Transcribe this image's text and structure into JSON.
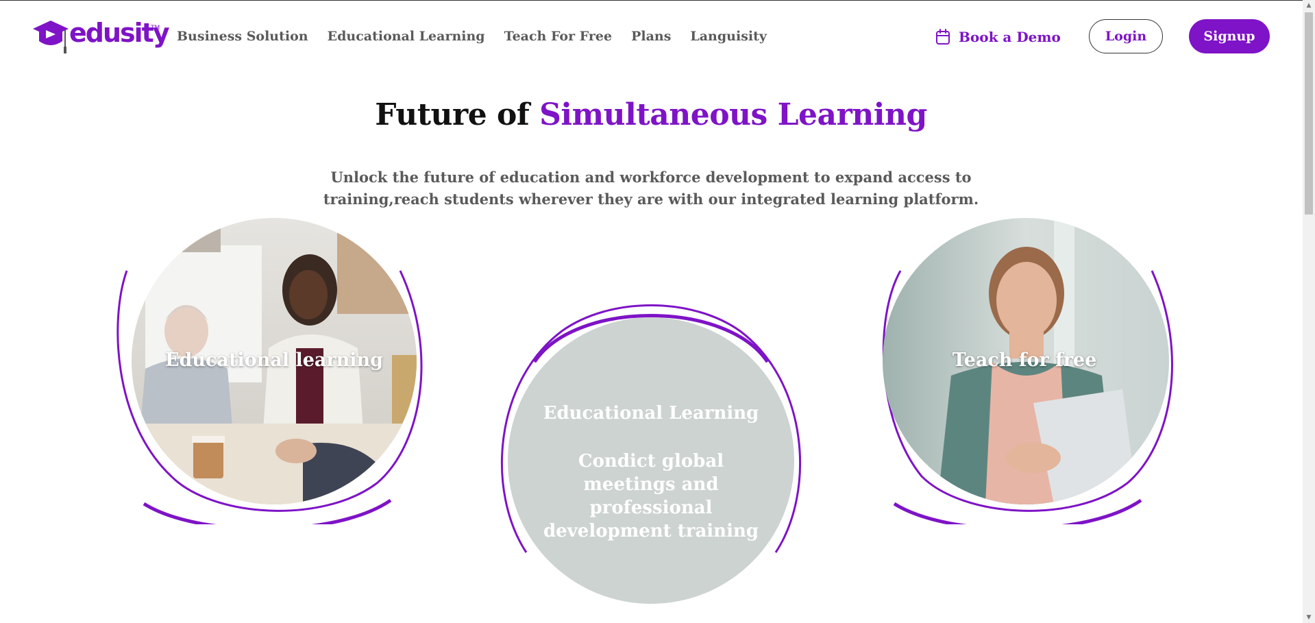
{
  "brand": {
    "name": "edusity",
    "tm": "TM",
    "color": "#7e13c7"
  },
  "nav": {
    "items": [
      {
        "label": "Business Solution"
      },
      {
        "label": "Educational Learning"
      },
      {
        "label": "Teach For Free"
      },
      {
        "label": "Plans"
      },
      {
        "label": "Languisity"
      }
    ]
  },
  "header_actions": {
    "demo_label": "Book a Demo",
    "login_label": "Login",
    "signup_label": "Signup"
  },
  "hero": {
    "title_prefix": "Future of ",
    "title_accent": "Simultaneous Learning",
    "subtitle": "Unlock the future of education and workforce development to expand access to training,reach students wherever they are with our integrated learning platform."
  },
  "cards": {
    "left": {
      "label": "Educational learning"
    },
    "center": {
      "title": "Educational Learning",
      "description": "Condict global meetings and professional development training"
    },
    "right": {
      "label": "Teach for free"
    }
  },
  "icons": {
    "calendar": "calendar-icon",
    "logo": "graduation-cap-icon"
  }
}
